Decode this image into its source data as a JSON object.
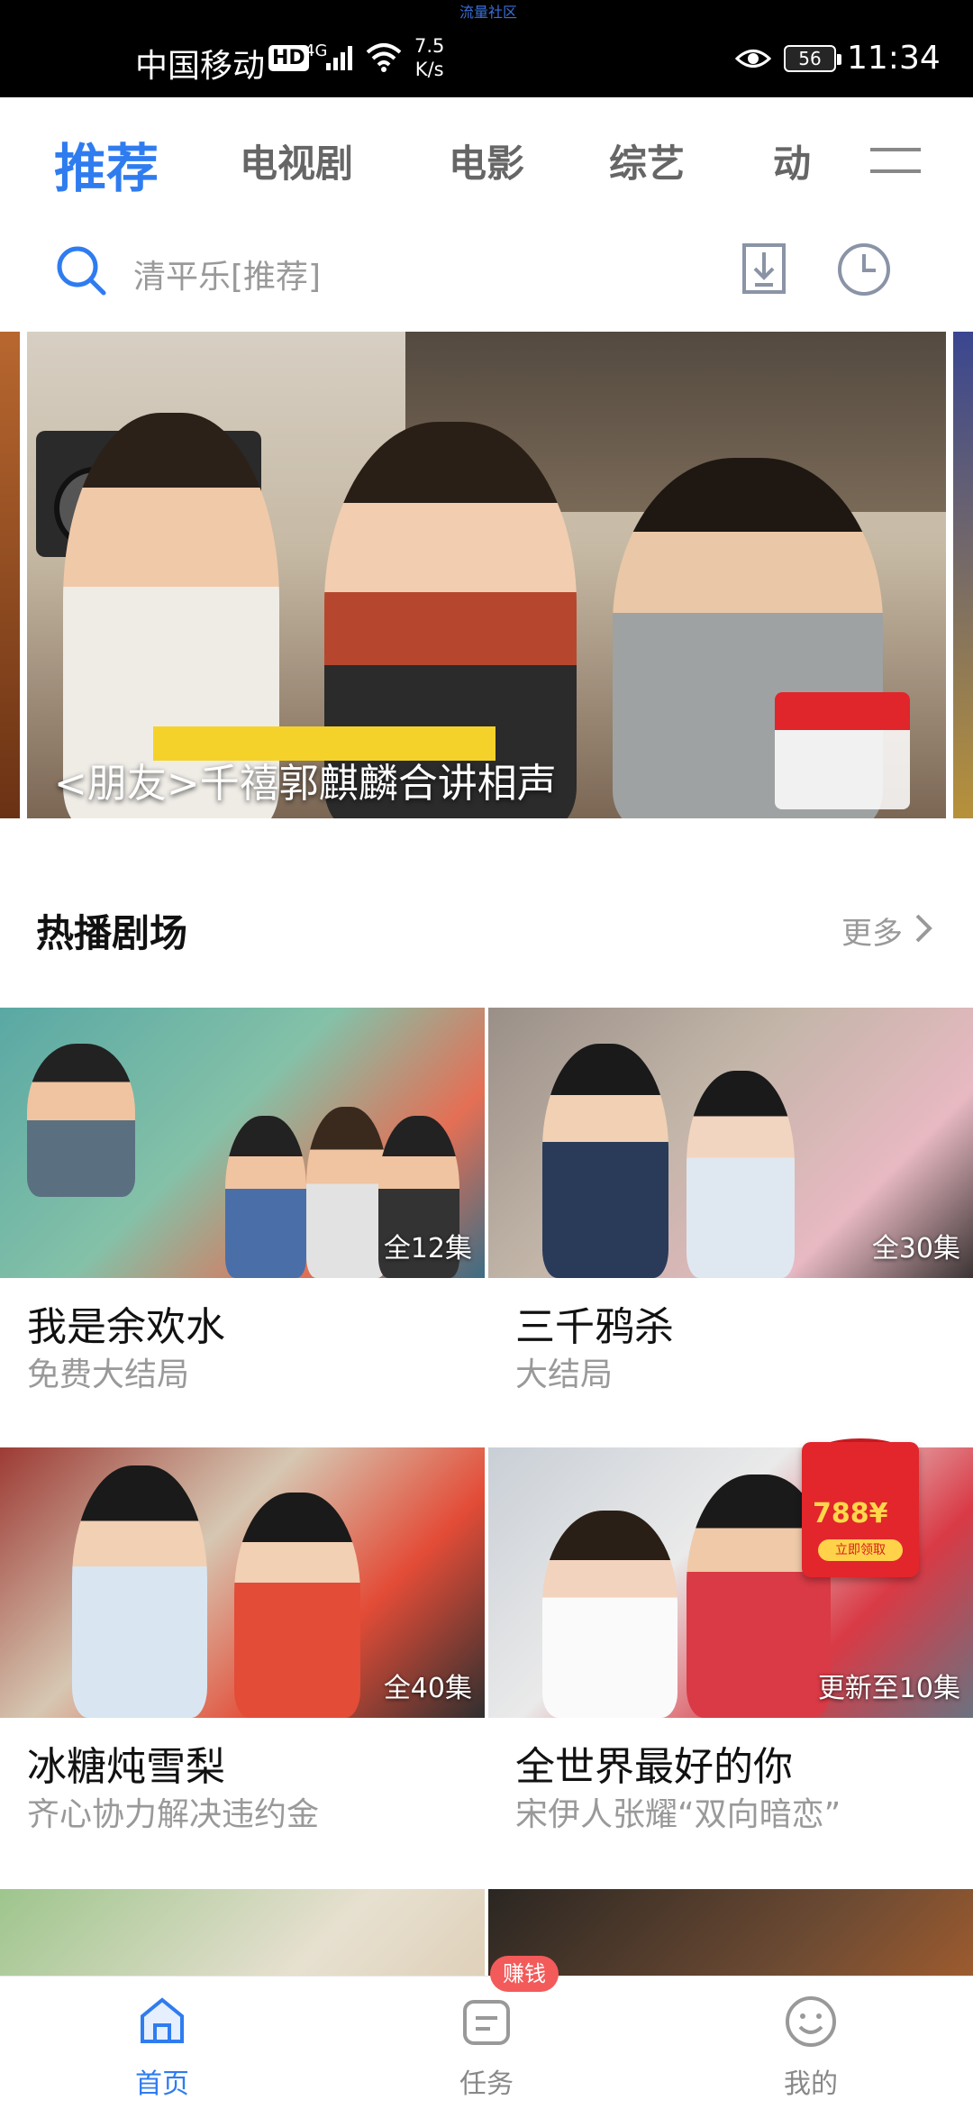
{
  "status_bar": {
    "carrier": "中国移动",
    "hd": "HD",
    "network": "4G",
    "speed_value": "7.5",
    "speed_unit": "K/s",
    "top_caption": "流量社区",
    "battery": "56",
    "time": "11:34"
  },
  "tabs": [
    {
      "label": "推荐",
      "active": true
    },
    {
      "label": "电视剧",
      "active": false
    },
    {
      "label": "电影",
      "active": false
    },
    {
      "label": "综艺",
      "active": false
    },
    {
      "label": "动",
      "active": false
    }
  ],
  "search": {
    "placeholder": "清平乐[推荐]"
  },
  "banner": {
    "caption": "<朋友>千禧郭麒麟合讲相声"
  },
  "section": {
    "title": "热播剧场",
    "more": "更多"
  },
  "cards": [
    {
      "title": "我是余欢水",
      "subtitle": "免费大结局",
      "badge": "全12集"
    },
    {
      "title": "三千鸦杀",
      "subtitle": "大结局",
      "badge": "全30集"
    },
    {
      "title": "冰糖炖雪梨",
      "subtitle": "齐心协力解决违约金",
      "badge": "全40集"
    },
    {
      "title": "全世界最好的你",
      "subtitle": "宋伊人张耀“双向暗恋”",
      "badge": "更新至10集"
    }
  ],
  "red_packet": {
    "amount": "788¥",
    "button": "立即领取"
  },
  "bottom_nav": [
    {
      "label": "首页",
      "active": true
    },
    {
      "label": "任务",
      "active": false
    },
    {
      "label": "我的",
      "active": false
    }
  ],
  "earn_badge": "赚钱",
  "colors": {
    "accent": "#2f7cf0",
    "badge_red": "#f35a5a"
  }
}
